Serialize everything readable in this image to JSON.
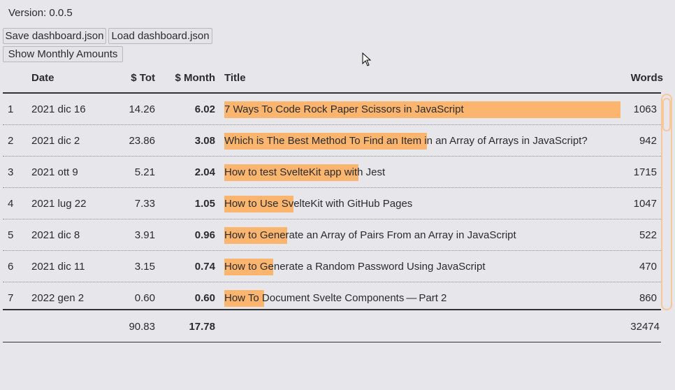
{
  "app": {
    "version_label": "Version: 0.0.5"
  },
  "toolbar": {
    "save_label": "Save dashboard.json",
    "load_label": "Load dashboard.json",
    "monthly_label": "Show Monthly Amounts"
  },
  "table": {
    "headers": {
      "rank": "",
      "date": "Date",
      "tot": "$ Tot",
      "month": "$ Month",
      "title": "Title",
      "words": "Words"
    },
    "rows": [
      {
        "rank": "1",
        "date": "2021 dic 16",
        "tot": "14.26",
        "month": "6.02",
        "title": "7 Ways To Code Rock Paper Scissors in JavaScript",
        "words": "1063",
        "bar_fraction": 1.0
      },
      {
        "rank": "2",
        "date": "2021 dic 2",
        "tot": "23.86",
        "month": "3.08",
        "title": "Which is The Best Method To Find an Item in an Array of Arrays in JavaScript?",
        "words": "942",
        "bar_fraction": 0.5116
      },
      {
        "rank": "3",
        "date": "2021 ott 9",
        "tot": "5.21",
        "month": "2.04",
        "title": "How to test SvelteKit app with Jest",
        "words": "1715",
        "bar_fraction": 0.3389
      },
      {
        "rank": "4",
        "date": "2021 lug 22",
        "tot": "7.33",
        "month": "1.05",
        "title": "How to Use SvelteKit with GitHub Pages",
        "words": "1047",
        "bar_fraction": 0.1744
      },
      {
        "rank": "5",
        "date": "2021 dic 8",
        "tot": "3.91",
        "month": "0.96",
        "title": "How to Generate an Array of Pairs From an Array in JavaScript",
        "words": "522",
        "bar_fraction": 0.1595
      },
      {
        "rank": "6",
        "date": "2021 dic 11",
        "tot": "3.15",
        "month": "0.74",
        "title": "How to Generate a Random Password Using JavaScript",
        "words": "470",
        "bar_fraction": 0.1229
      },
      {
        "rank": "7",
        "date": "2022 gen 2",
        "tot": "0.60",
        "month": "0.60",
        "title": "How To Document Svelte Components — Part 2",
        "words": "860",
        "bar_fraction": 0.0997
      }
    ],
    "footer": {
      "tot": "90.83",
      "month": "17.78",
      "words": "32474"
    }
  },
  "colors": {
    "bar": "#fbb56f",
    "background": "#e7e6ea",
    "scrollbar": "#f6c79a"
  }
}
